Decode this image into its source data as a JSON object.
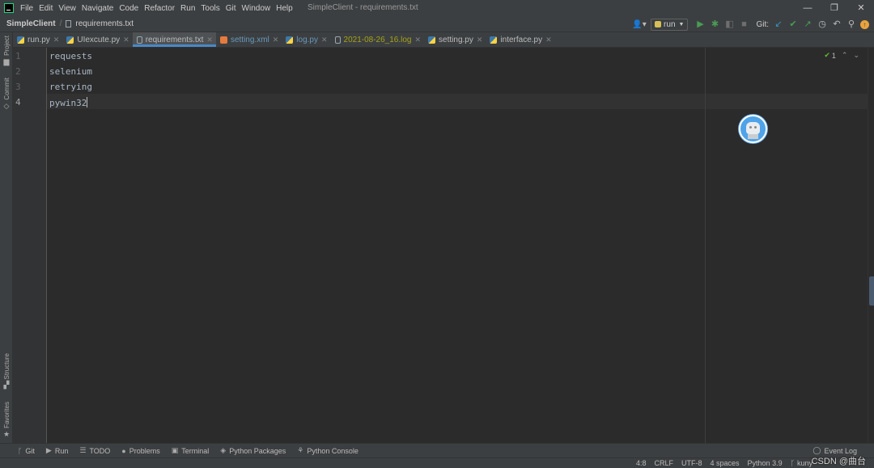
{
  "menu": {
    "items": [
      "File",
      "Edit",
      "View",
      "Navigate",
      "Code",
      "Refactor",
      "Run",
      "Tools",
      "Git",
      "Window",
      "Help"
    ],
    "window_title": "SimpleClient - requirements.txt"
  },
  "navbar": {
    "project": "SimpleClient",
    "file": "requirements.txt"
  },
  "toolbar": {
    "run_config": "run",
    "git_label": "Git:"
  },
  "left_strip": {
    "project": "Project",
    "commit": "Commit",
    "structure": "Structure",
    "favorites": "Favorites"
  },
  "tabs": [
    {
      "label": "run.py",
      "icon": "python-file-icon",
      "active": false
    },
    {
      "label": "UIexcute.py",
      "icon": "python-file-icon",
      "active": false
    },
    {
      "label": "requirements.txt",
      "icon": "text-file-icon",
      "active": true
    },
    {
      "label": "setting.xml",
      "icon": "xml-file-icon",
      "active": false
    },
    {
      "label": "log.py",
      "icon": "python-file-icon",
      "active": false
    },
    {
      "label": "2021-08-26_16.log",
      "icon": "log-file-icon",
      "active": false
    },
    {
      "label": "setting.py",
      "icon": "python-file-icon",
      "active": false
    },
    {
      "label": "interface.py",
      "icon": "python-file-icon",
      "active": false
    }
  ],
  "tab_colors": {
    "setting.xml": "#6897bb",
    "log.py": "#6897bb",
    "2021-08-26_16.log": "#a5a218"
  },
  "editor": {
    "lines": [
      "requests",
      "selenium",
      "retrying",
      "pywin32"
    ],
    "line_numbers": [
      "1",
      "2",
      "3",
      "4"
    ],
    "inspection_count": "1"
  },
  "tool_windows": [
    "Git",
    "Run",
    "TODO",
    "Problems",
    "Terminal",
    "Python Packages",
    "Python Console"
  ],
  "event_log": "Event Log",
  "status": {
    "position": "4:8",
    "line_separator": "CRLF",
    "encoding": "UTF-8",
    "indent": "4 spaces",
    "interpreter": "Python 3.9",
    "branch": "kuny"
  },
  "watermark": "CSDN @曲台"
}
